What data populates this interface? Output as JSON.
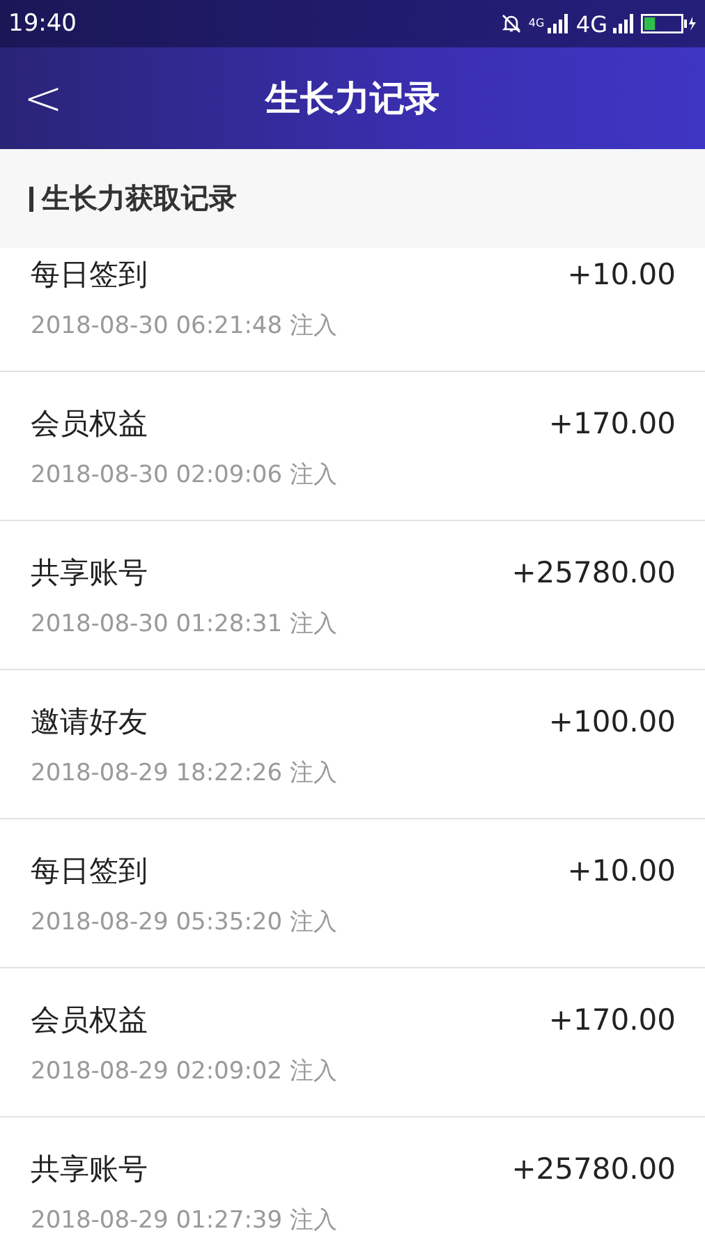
{
  "status_bar": {
    "time": "19:40",
    "network_small": "4G",
    "network": "4G",
    "battery": {
      "level": 0.3
    }
  },
  "header": {
    "back": "<",
    "title": "生长力记录"
  },
  "section": {
    "title": "生长力获取记录"
  },
  "records": [
    {
      "title": "每日签到",
      "time": "2018-08-30 06:21:48 注入",
      "amount": "+10.00"
    },
    {
      "title": "会员权益",
      "time": "2018-08-30 02:09:06 注入",
      "amount": "+170.00"
    },
    {
      "title": "共享账号",
      "time": "2018-08-30 01:28:31 注入",
      "amount": "+25780.00"
    },
    {
      "title": "邀请好友",
      "time": "2018-08-29 18:22:26 注入",
      "amount": "+100.00"
    },
    {
      "title": "每日签到",
      "time": "2018-08-29 05:35:20 注入",
      "amount": "+10.00"
    },
    {
      "title": "会员权益",
      "time": "2018-08-29 02:09:02 注入",
      "amount": "+170.00"
    },
    {
      "title": "共享账号",
      "time": "2018-08-29 01:27:39 注入",
      "amount": "+25780.00"
    }
  ]
}
